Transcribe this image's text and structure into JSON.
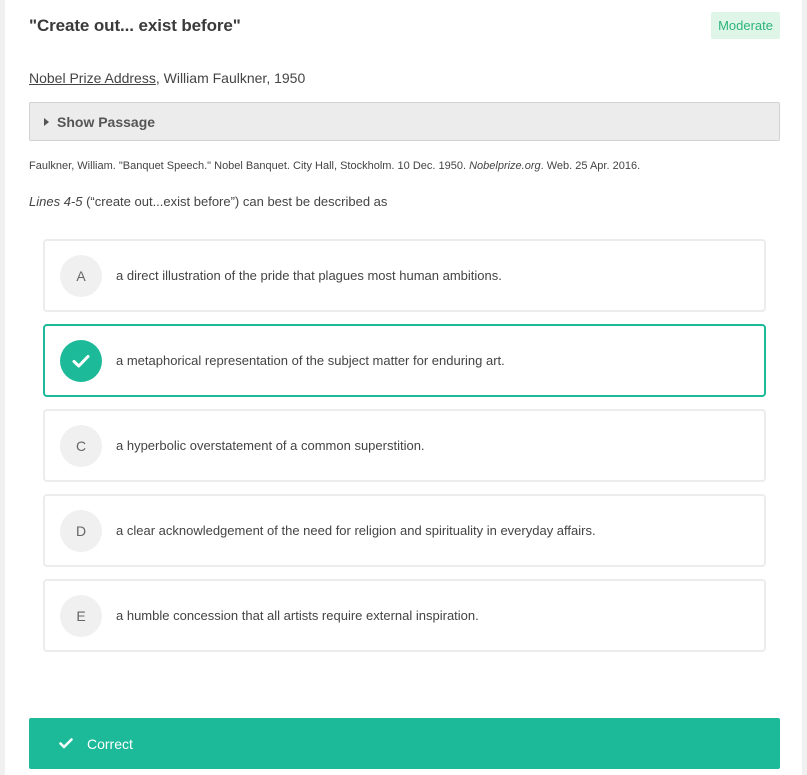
{
  "question": {
    "title": "\"Create out... exist before\"",
    "difficulty": "Moderate"
  },
  "source": {
    "link_text": "Nobel Prize Address",
    "rest": ", William Faulkner, 1950"
  },
  "passage": {
    "toggle_label": "Show Passage"
  },
  "citation": {
    "pre": "Faulkner, William. \"Banquet Speech.\" Nobel Banquet. City Hall, Stockholm. 10 Dec. 1950. ",
    "italic": "Nobelprize.org",
    "post": ". Web. 25 Apr. 2016."
  },
  "prompt": {
    "lines_ref": "Lines 4-5",
    "text": " (“create out...exist before”) can best be described as"
  },
  "choices": [
    {
      "letter": "A",
      "text": "a direct illustration of the pride that plagues most human ambitions.",
      "selected": false
    },
    {
      "letter": "B",
      "text": "a metaphorical representation of the subject matter for enduring art.",
      "selected": true
    },
    {
      "letter": "C",
      "text": "a hyperbolic overstatement of a common superstition.",
      "selected": false
    },
    {
      "letter": "D",
      "text": "a clear acknowledgement of the need for religion and spirituality in everyday affairs.",
      "selected": false
    },
    {
      "letter": "E",
      "text": "a humble concession that all artists require external inspiration.",
      "selected": false
    }
  ],
  "result": {
    "label": "Correct",
    "icon": "check-icon"
  },
  "colors": {
    "accent": "#1dba99",
    "difficulty_bg": "#dff5e8",
    "difficulty_text": "#2cb57a"
  }
}
